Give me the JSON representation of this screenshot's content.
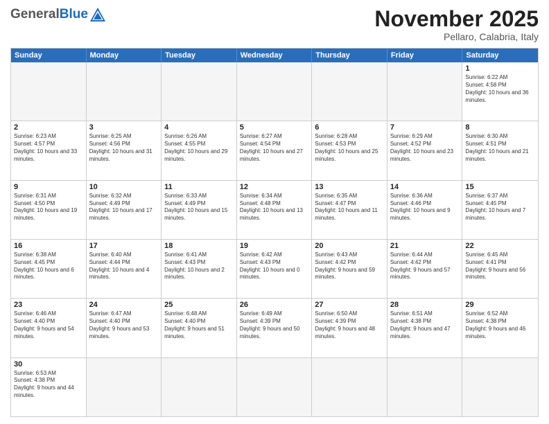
{
  "header": {
    "logo": {
      "general": "General",
      "blue": "Blue"
    },
    "title": "November 2025",
    "location": "Pellaro, Calabria, Italy"
  },
  "calendar": {
    "days_of_week": [
      "Sunday",
      "Monday",
      "Tuesday",
      "Wednesday",
      "Thursday",
      "Friday",
      "Saturday"
    ],
    "weeks": [
      [
        {
          "day": "",
          "info": ""
        },
        {
          "day": "",
          "info": ""
        },
        {
          "day": "",
          "info": ""
        },
        {
          "day": "",
          "info": ""
        },
        {
          "day": "",
          "info": ""
        },
        {
          "day": "",
          "info": ""
        },
        {
          "day": "1",
          "info": "Sunrise: 6:22 AM\nSunset: 4:58 PM\nDaylight: 10 hours and 36 minutes."
        }
      ],
      [
        {
          "day": "2",
          "info": "Sunrise: 6:23 AM\nSunset: 4:57 PM\nDaylight: 10 hours and 33 minutes."
        },
        {
          "day": "3",
          "info": "Sunrise: 6:25 AM\nSunset: 4:56 PM\nDaylight: 10 hours and 31 minutes."
        },
        {
          "day": "4",
          "info": "Sunrise: 6:26 AM\nSunset: 4:55 PM\nDaylight: 10 hours and 29 minutes."
        },
        {
          "day": "5",
          "info": "Sunrise: 6:27 AM\nSunset: 4:54 PM\nDaylight: 10 hours and 27 minutes."
        },
        {
          "day": "6",
          "info": "Sunrise: 6:28 AM\nSunset: 4:53 PM\nDaylight: 10 hours and 25 minutes."
        },
        {
          "day": "7",
          "info": "Sunrise: 6:29 AM\nSunset: 4:52 PM\nDaylight: 10 hours and 23 minutes."
        },
        {
          "day": "8",
          "info": "Sunrise: 6:30 AM\nSunset: 4:51 PM\nDaylight: 10 hours and 21 minutes."
        }
      ],
      [
        {
          "day": "9",
          "info": "Sunrise: 6:31 AM\nSunset: 4:50 PM\nDaylight: 10 hours and 19 minutes."
        },
        {
          "day": "10",
          "info": "Sunrise: 6:32 AM\nSunset: 4:49 PM\nDaylight: 10 hours and 17 minutes."
        },
        {
          "day": "11",
          "info": "Sunrise: 6:33 AM\nSunset: 4:49 PM\nDaylight: 10 hours and 15 minutes."
        },
        {
          "day": "12",
          "info": "Sunrise: 6:34 AM\nSunset: 4:48 PM\nDaylight: 10 hours and 13 minutes."
        },
        {
          "day": "13",
          "info": "Sunrise: 6:35 AM\nSunset: 4:47 PM\nDaylight: 10 hours and 11 minutes."
        },
        {
          "day": "14",
          "info": "Sunrise: 6:36 AM\nSunset: 4:46 PM\nDaylight: 10 hours and 9 minutes."
        },
        {
          "day": "15",
          "info": "Sunrise: 6:37 AM\nSunset: 4:45 PM\nDaylight: 10 hours and 7 minutes."
        }
      ],
      [
        {
          "day": "16",
          "info": "Sunrise: 6:38 AM\nSunset: 4:45 PM\nDaylight: 10 hours and 6 minutes."
        },
        {
          "day": "17",
          "info": "Sunrise: 6:40 AM\nSunset: 4:44 PM\nDaylight: 10 hours and 4 minutes."
        },
        {
          "day": "18",
          "info": "Sunrise: 6:41 AM\nSunset: 4:43 PM\nDaylight: 10 hours and 2 minutes."
        },
        {
          "day": "19",
          "info": "Sunrise: 6:42 AM\nSunset: 4:43 PM\nDaylight: 10 hours and 0 minutes."
        },
        {
          "day": "20",
          "info": "Sunrise: 6:43 AM\nSunset: 4:42 PM\nDaylight: 9 hours and 59 minutes."
        },
        {
          "day": "21",
          "info": "Sunrise: 6:44 AM\nSunset: 4:42 PM\nDaylight: 9 hours and 57 minutes."
        },
        {
          "day": "22",
          "info": "Sunrise: 6:45 AM\nSunset: 4:41 PM\nDaylight: 9 hours and 56 minutes."
        }
      ],
      [
        {
          "day": "23",
          "info": "Sunrise: 6:46 AM\nSunset: 4:40 PM\nDaylight: 9 hours and 54 minutes."
        },
        {
          "day": "24",
          "info": "Sunrise: 6:47 AM\nSunset: 4:40 PM\nDaylight: 9 hours and 53 minutes."
        },
        {
          "day": "25",
          "info": "Sunrise: 6:48 AM\nSunset: 4:40 PM\nDaylight: 9 hours and 51 minutes."
        },
        {
          "day": "26",
          "info": "Sunrise: 6:49 AM\nSunset: 4:39 PM\nDaylight: 9 hours and 50 minutes."
        },
        {
          "day": "27",
          "info": "Sunrise: 6:50 AM\nSunset: 4:39 PM\nDaylight: 9 hours and 48 minutes."
        },
        {
          "day": "28",
          "info": "Sunrise: 6:51 AM\nSunset: 4:38 PM\nDaylight: 9 hours and 47 minutes."
        },
        {
          "day": "29",
          "info": "Sunrise: 6:52 AM\nSunset: 4:38 PM\nDaylight: 9 hours and 46 minutes."
        }
      ],
      [
        {
          "day": "30",
          "info": "Sunrise: 6:53 AM\nSunset: 4:38 PM\nDaylight: 9 hours and 44 minutes."
        },
        {
          "day": "",
          "info": ""
        },
        {
          "day": "",
          "info": ""
        },
        {
          "day": "",
          "info": ""
        },
        {
          "day": "",
          "info": ""
        },
        {
          "day": "",
          "info": ""
        },
        {
          "day": "",
          "info": ""
        }
      ]
    ]
  }
}
